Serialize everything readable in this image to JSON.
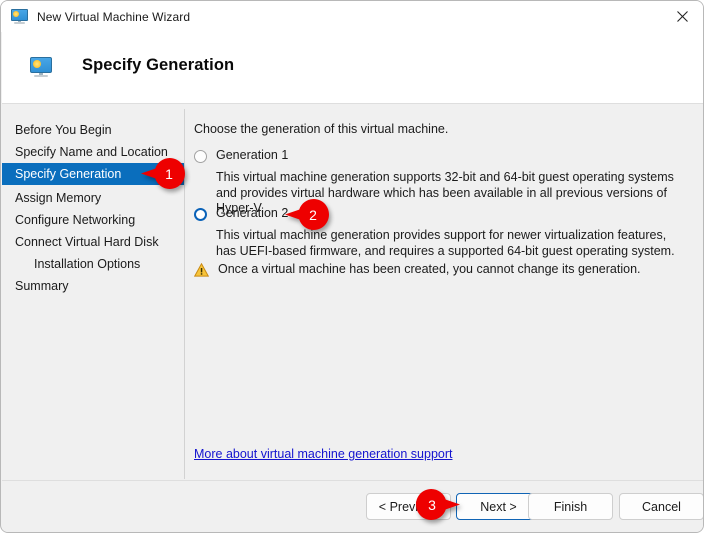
{
  "window": {
    "title": "New Virtual Machine Wizard",
    "title_icon": "virtual-machine-icon",
    "close_icon": "close-icon"
  },
  "header": {
    "icon": "virtual-machine-icon",
    "title": "Specify Generation"
  },
  "sidebar": {
    "items": [
      {
        "label": "Before You Begin",
        "selected": false,
        "indent": false
      },
      {
        "label": "Specify Name and Location",
        "selected": false,
        "indent": false
      },
      {
        "label": "Specify Generation",
        "selected": true,
        "indent": false
      },
      {
        "label": "Assign Memory",
        "selected": false,
        "indent": false
      },
      {
        "label": "Configure Networking",
        "selected": false,
        "indent": false
      },
      {
        "label": "Connect Virtual Hard Disk",
        "selected": false,
        "indent": false
      },
      {
        "label": "Installation Options",
        "selected": false,
        "indent": true
      },
      {
        "label": "Summary",
        "selected": false,
        "indent": false
      }
    ],
    "selected_bg": "#0a6ebd"
  },
  "main": {
    "intro": "Choose the generation of this virtual machine.",
    "options": [
      {
        "label": "Generation 1",
        "selected": false,
        "description": "This virtual machine generation supports 32-bit and 64-bit guest operating systems and provides virtual hardware which has been available in all previous versions of Hyper-V."
      },
      {
        "label": "Generation 2",
        "selected": true,
        "description": "This virtual machine generation provides support for newer virtualization features, has UEFI-based firmware, and requires a supported 64-bit guest operating system."
      }
    ],
    "warning": {
      "icon": "warning-triangle-icon",
      "text": "Once a virtual machine has been created, you cannot change its generation."
    },
    "link": {
      "label": "More about virtual machine generation support",
      "color": "#1414cf"
    }
  },
  "footer": {
    "buttons": [
      {
        "label": "< Previous",
        "default": false
      },
      {
        "label": "Next >",
        "default": true
      },
      {
        "label": "Finish",
        "default": false
      },
      {
        "label": "Cancel",
        "default": false
      }
    ]
  },
  "callouts": [
    {
      "number": "1",
      "direction": "left",
      "color": "#ee0000"
    },
    {
      "number": "2",
      "direction": "left",
      "color": "#ee0000"
    },
    {
      "number": "3",
      "direction": "right",
      "color": "#ee0000"
    }
  ]
}
